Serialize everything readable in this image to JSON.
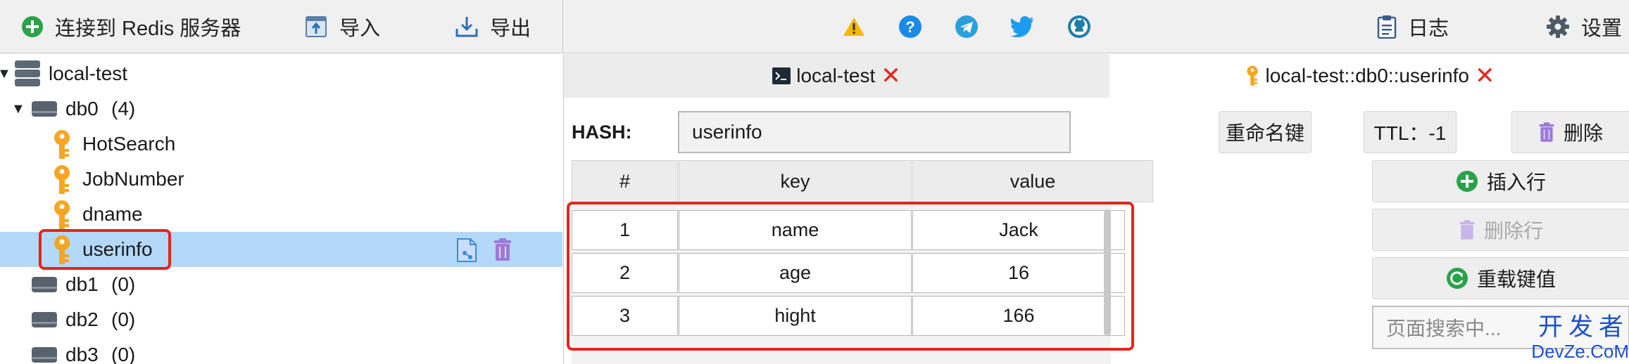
{
  "toolbar": {
    "connect_label": "连接到 Redis 服务器",
    "import_label": "导入",
    "export_label": "导出",
    "center_icons": [
      "warning-icon",
      "help-icon",
      "telegram-icon",
      "twitter-icon",
      "github-icon"
    ],
    "log_label": "日志",
    "settings_label": "设置"
  },
  "tree": {
    "connection": "local-test",
    "databases": [
      {
        "name": "db0",
        "count": "(4)",
        "expanded": true
      },
      {
        "name": "db1",
        "count": "(0)",
        "expanded": false
      },
      {
        "name": "db2",
        "count": "(0)",
        "expanded": false
      },
      {
        "name": "db3",
        "count": "(0)",
        "expanded": false
      }
    ],
    "keys": [
      "HotSearch",
      "JobNumber",
      "dname",
      "userinfo"
    ],
    "selected_key": "userinfo"
  },
  "tabs": [
    {
      "label": "local-test",
      "icon": "terminal-icon",
      "active": false
    },
    {
      "label": "local-test::db0::userinfo",
      "icon": "key-icon",
      "active": true
    }
  ],
  "editor": {
    "type_label": "HASH:",
    "key_name": "userinfo",
    "rename_label": "重命名键",
    "ttl_label": "TTL：-1",
    "delete_label": "删除"
  },
  "table": {
    "columns": [
      "#",
      "key",
      "value"
    ],
    "rows": [
      {
        "index": "1",
        "key": "name",
        "value": "Jack"
      },
      {
        "index": "2",
        "key": "age",
        "value": "16"
      },
      {
        "index": "3",
        "key": "hight",
        "value": "166"
      }
    ]
  },
  "actions": {
    "insert_row": "插入行",
    "delete_row": "删除行",
    "reload": "重载键值",
    "search_placeholder": "页面搜索中..."
  },
  "watermark": {
    "top": "开发者",
    "bottom": "DevZe.CoM"
  },
  "colors": {
    "highlight": "#e3261c",
    "selected_row": "#b4d8f8",
    "key_icon": "#f5a623",
    "db_icon": "#58626d",
    "trash": "#9b7ad8",
    "accent_green": "#2aa24a"
  }
}
